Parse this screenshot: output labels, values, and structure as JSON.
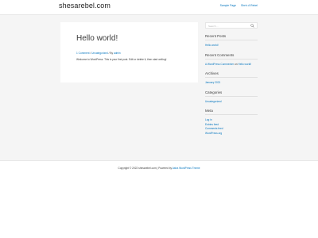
{
  "header": {
    "site_title": "shesarebel.com",
    "nav": [
      "Sample Page",
      "She's A Rebel"
    ]
  },
  "article": {
    "title": "Hello world!",
    "meta": {
      "comments": "1 Comment",
      "separator_1": " / ",
      "category": "Uncategorized",
      "separator_2": " / By ",
      "author": "admin"
    },
    "content": "Welcome to WordPress. This is your first post. Edit or delete it, then start writing!"
  },
  "sidebar": {
    "search": {
      "placeholder": "Search ..."
    },
    "recent_posts": {
      "title": "Recent Posts",
      "items": [
        "Hello world!"
      ]
    },
    "recent_comments": {
      "title": "Recent Comments",
      "items": [
        {
          "author": "A WordPress Commenter",
          "middle": " on ",
          "post": "Hello world!"
        }
      ]
    },
    "archives": {
      "title": "Archives",
      "items": [
        "January 2021"
      ]
    },
    "categories": {
      "title": "Categories",
      "items": [
        "Uncategorized"
      ]
    },
    "meta": {
      "title": "Meta",
      "items": [
        "Log in",
        "Entries feed",
        "Comments feed",
        "WordPress.org"
      ]
    }
  },
  "footer": {
    "prefix": "Copyright © 2022 shesarebel.com | Powered by ",
    "link": "Astra WordPress Theme"
  },
  "colors": {
    "accent": "#0274be",
    "text": "#3a3a3a",
    "background": "#f5f5f5",
    "surface": "#ffffff"
  }
}
